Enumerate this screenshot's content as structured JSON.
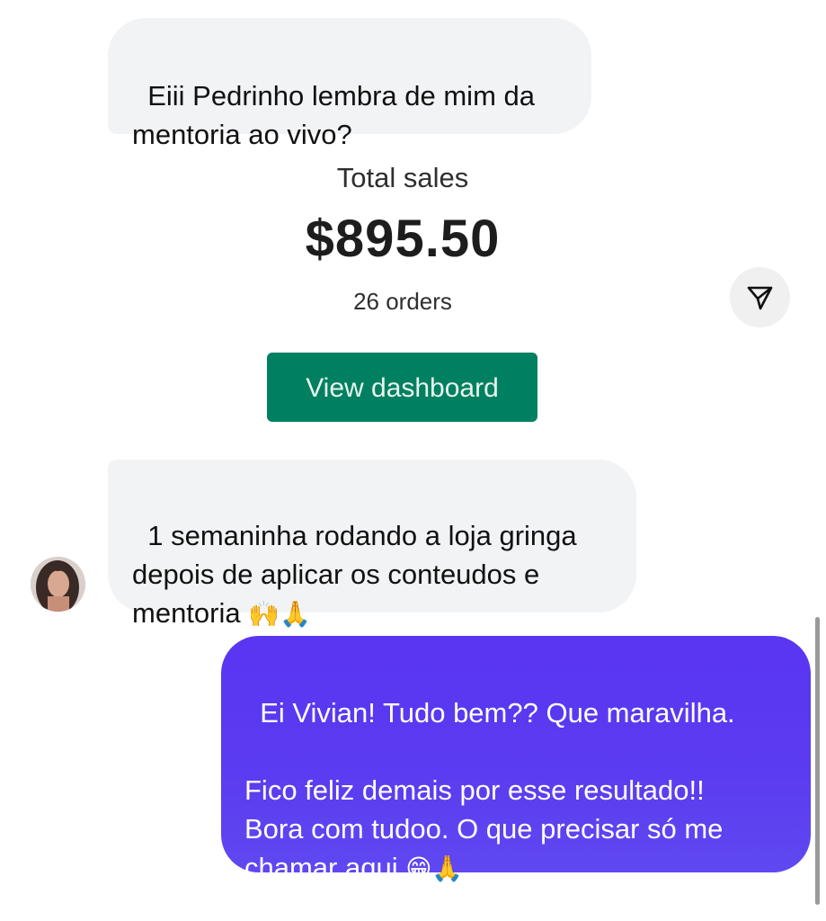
{
  "messages": {
    "msg1": {
      "text": "Eiii Pedrinho lembra de mim da\nmentoria ao vivo?"
    },
    "msg2": {
      "text": "1 semaninha rodando a loja gringa\ndepois de aplicar os conteudos e\nmentoria ",
      "emojis": "🙌🙏"
    },
    "msg3": {
      "text": "Ei Vivian! Tudo bem?? Que maravilha.\n\nFico feliz demais por esse resultado!!\nBora com tudoo. O que precisar só me\nchamar aqui ",
      "emojis": "😁🙏"
    }
  },
  "sales_card": {
    "label": "Total sales",
    "value": "$895.50",
    "orders": "26 orders",
    "button_label": "View dashboard"
  },
  "icons": {
    "share": "send-icon",
    "avatar": "avatar"
  },
  "colors": {
    "incoming_bubble": "#f2f3f5",
    "outgoing_bubble": "#5a35f2",
    "dashboard_button": "#008060"
  }
}
